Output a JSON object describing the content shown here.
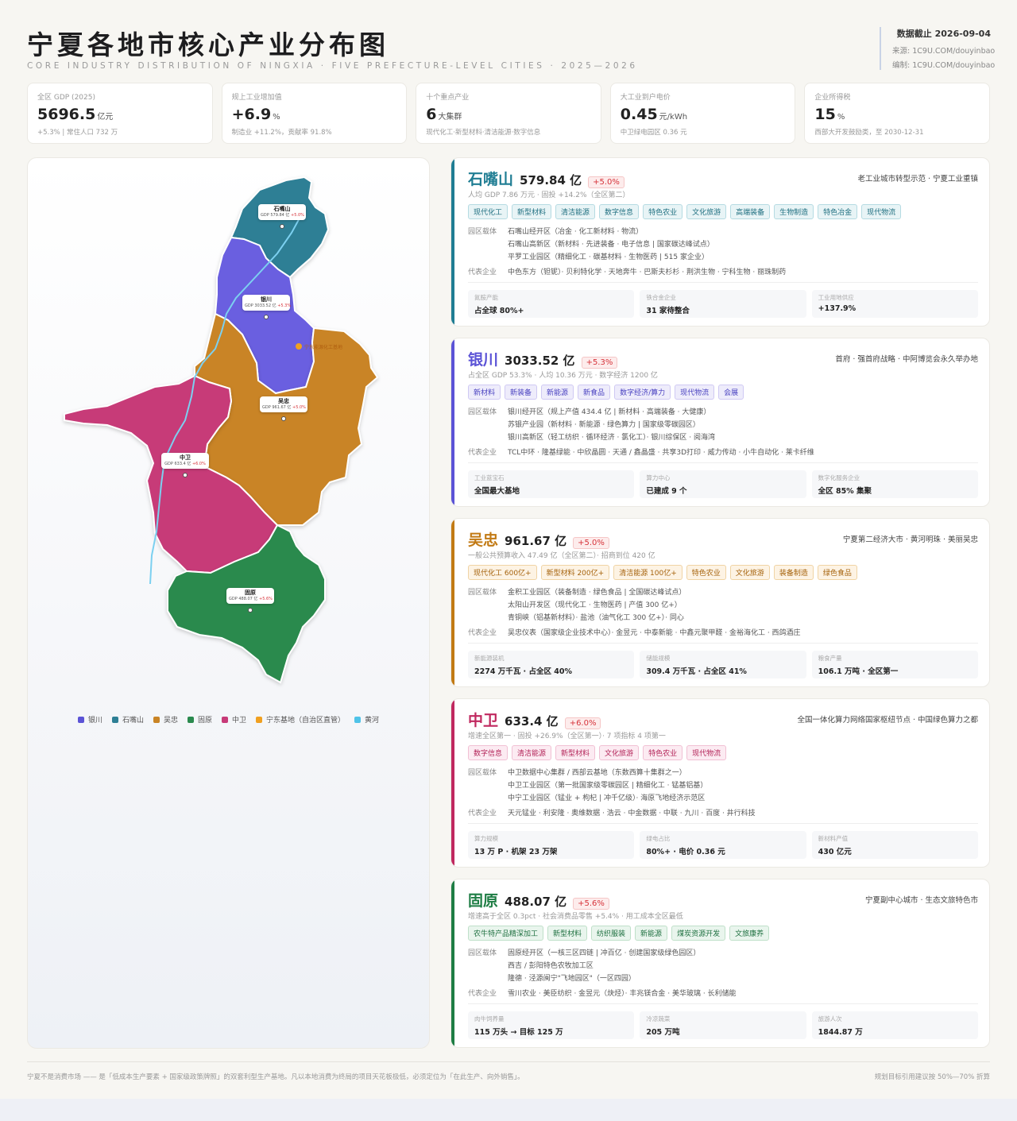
{
  "header": {
    "title": "宁夏各地市核心产业分布图",
    "subtitle": "CORE INDUSTRY DISTRIBUTION OF NINGXIA · FIVE PREFECTURE-LEVEL CITIES · 2025—2026",
    "date": "数据截止 2026-09-04",
    "source": "来源: 1C9U.COM/douyinbao",
    "editor": "编制: 1C9U.COM/douyinbao"
  },
  "kpis": [
    {
      "label": "全区 GDP (2025)",
      "value": "5696.5",
      "unit": "亿元",
      "note": "+5.3% | 常住人口 732 万"
    },
    {
      "label": "规上工业增加值",
      "value": "+6.9",
      "unit": "%",
      "note": "制造业 +11.2%，贡献率 91.8%"
    },
    {
      "label": "十个重点产业",
      "value": "6",
      "unit": "大集群",
      "note": "现代化工·新型材料·清洁能源·数字信息"
    },
    {
      "label": "大工业到户电价",
      "value": "0.45",
      "unit": "元/kWh",
      "note": "中卫绿电园区 0.36 元"
    },
    {
      "label": "企业所得税",
      "value": "15",
      "unit": "%",
      "note": "西部大开发鼓励类，至 2030-12-31"
    }
  ],
  "map": {
    "labels": [
      {
        "name": "石嘴山",
        "gdp": "GDP 579.84 亿",
        "growth": "+5.0%"
      },
      {
        "name": "银川",
        "gdp": "GDP 3033.52 亿",
        "growth": "+5.3%"
      },
      {
        "name": "吴忠",
        "gdp": "GDP 961.67 亿",
        "growth": "+5.0%"
      },
      {
        "name": "中卫",
        "gdp": "GDP 633.4 亿",
        "growth": "+6.0%"
      },
      {
        "name": "固原",
        "gdp": "GDP 488.07 亿",
        "growth": "+5.6%"
      }
    ],
    "base_label": "宁东能源化工基地",
    "legend": [
      {
        "name": "银川",
        "color": "#5b53d6"
      },
      {
        "name": "石嘴山",
        "color": "#2d7f95"
      },
      {
        "name": "吴忠",
        "color": "#c98425"
      },
      {
        "name": "固原",
        "color": "#2a8a4e"
      },
      {
        "name": "中卫",
        "color": "#c73a78"
      },
      {
        "name": "宁东基地（自治区直管）",
        "color": "#f0a020"
      },
      {
        "name": "黄河",
        "color": "#4fc3e8"
      }
    ],
    "colors": {
      "shizuishan": "#2d7f95",
      "yinchuan": "#6b5ee0",
      "wuzhong": "#c98425",
      "zhongwei": "#c73a78",
      "guyuan": "#2a8a4e",
      "river": "#7cd0f0",
      "base": "#f0a020"
    }
  },
  "cities": [
    {
      "name": "石嘴山",
      "gdp": "579.84 亿",
      "growth": "+5.0%",
      "color": "#1f7d93",
      "tagline": "老工业城市转型示范 · 宁夏工业重镇",
      "sub": "人均 GDP 7.86 万元 · 固投 +14.2%（全区第二）",
      "tags": [
        "现代化工",
        "新型材料",
        "清洁能源",
        "数字信息",
        "特色农业",
        "文化旅游",
        "高端装备",
        "生物制造",
        "特色冶金",
        "现代物流"
      ],
      "tag_bg": "#e8f4f6",
      "tag_border": "#b5dbe2",
      "tag_color": "#1f6f80",
      "parks_label": "园区载体",
      "parks": [
        "石嘴山经开区（冶金 · 化工新材料 · 物流）",
        "石嘴山高新区（新材料 · 先进装备 · 电子信息 | 国家碳达峰试点）",
        "平罗工业园区（精细化工 · 碳基材料 · 生物医药 | 515 家企业）"
      ],
      "companies_label": "代表企业",
      "companies": "中色东方（钽铌）· 贝利特化学 · 天地奔牛 · 巴斯夫杉杉 · 荆洪生物 · 宁科生物 · 丽珠制药",
      "stats": [
        {
          "label": "氮胺产能",
          "value": "占全球 80%+"
        },
        {
          "label": "铁合金企业",
          "value": "31 家待整合"
        },
        {
          "label": "工业用地供应",
          "value": "+137.9%"
        }
      ]
    },
    {
      "name": "银川",
      "gdp": "3033.52 亿",
      "growth": "+5.3%",
      "color": "#5b53d6",
      "tagline": "首府 · 强首府战略 · 中阿博览会永久举办地",
      "sub": "占全区 GDP 53.3% · 人均 10.36 万元 · 数字经济 1200 亿",
      "tags": [
        "新材料",
        "新装备",
        "新能源",
        "新食品",
        "数字经济/算力",
        "现代物流",
        "会展"
      ],
      "tag_bg": "#eeecfb",
      "tag_border": "#cfc9f3",
      "tag_color": "#4a42c0",
      "parks_label": "园区载体",
      "parks": [
        "银川经开区（规上产值 434.4 亿 | 新材料 · 高端装备 · 大健康）",
        "苏银产业园（新材料 · 新能源 · 绿色算力 | 国家级零碳园区）",
        "银川高新区（轻工纺织 · 循环经济 · 氯化工）· 银川综保区 · 阅海湾"
      ],
      "companies_label": "代表企业",
      "companies": "TCL中环 · 隆基绿能 · 中欣晶圆 · 天通 / 鑫晶盛 · 共享3D打印 · 威力传动 · 小牛自动化 · 莱卡纤维",
      "stats": [
        {
          "label": "工业蓝宝石",
          "value": "全国最大基地"
        },
        {
          "label": "算力中心",
          "value": "已建成 9 个"
        },
        {
          "label": "数字化服务企业",
          "value": "全区 85% 集聚"
        }
      ]
    },
    {
      "name": "吴忠",
      "gdp": "961.67 亿",
      "growth": "+5.0%",
      "color": "#c27a14",
      "tagline": "宁夏第二经济大市 · 黄河明珠 · 美丽吴忠",
      "sub": "一般公共预算收入 47.49 亿（全区第二）· 招商到位 420 亿",
      "tags": [
        "现代化工 600亿+",
        "新型材料 200亿+",
        "清洁能源 100亿+",
        "特色农业",
        "文化旅游",
        "装备制造",
        "绿色食品"
      ],
      "tag_bg": "#fdf3e4",
      "tag_border": "#f0d4a5",
      "tag_color": "#a5620b",
      "parks_label": "园区载体",
      "parks": [
        "金积工业园区（装备制造 · 绿色食品 | 全国碳达峰试点）",
        "太阳山开发区（现代化工 · 生物医药 | 产值 300 亿+）",
        "青铜峡（铝基新材料）· 盐池（油气化工 300 亿+）· 同心"
      ],
      "companies_label": "代表企业",
      "companies": "吴忠仪表（国家级企业技术中心）· 金昱元 · 中泰新能 · 中鑫元聚甲醛 · 金裕海化工 · 西鸽酒庄",
      "stats": [
        {
          "label": "新能源装机",
          "value": "2274 万千瓦 · 占全区 40%"
        },
        {
          "label": "储能规模",
          "value": "309.4 万千瓦 · 占全区 41%"
        },
        {
          "label": "粮食产量",
          "value": "106.1 万吨 · 全区第一"
        }
      ]
    },
    {
      "name": "中卫",
      "gdp": "633.4 亿",
      "growth": "+6.0%",
      "color": "#c0285f",
      "tagline": "全国一体化算力网络国家枢纽节点 · 中国绿色算力之都",
      "sub": "增速全区第一 · 固投 +26.9%（全区第一）· 7 项指标 4 项第一",
      "tags": [
        "数字信息",
        "清洁能源",
        "新型材料",
        "文化旅游",
        "特色农业",
        "现代物流"
      ],
      "tag_bg": "#fcebf2",
      "tag_border": "#f1c0d4",
      "tag_color": "#b32358",
      "parks_label": "园区载体",
      "parks": [
        "中卫数据中心集群 / 西部云基地（东数西算十集群之一）",
        "中卫工业园区（第一批国家级零碳园区 | 精细化工 · 锰基铝基）",
        "中宁工业园区（锰业 + 枸杞 | 冲千亿级）· 海原飞地经济示范区"
      ],
      "companies_label": "代表企业",
      "companies": "天元锰业 · 利安隆 · 奥维数据 · 浩云 · 中金数据 · 中联 · 九川 · 百度 · 井行科技",
      "stats": [
        {
          "label": "算力规模",
          "value": "13 万 P · 机架 23 万架"
        },
        {
          "label": "绿电占比",
          "value": "80%+ · 电价 0.36 元"
        },
        {
          "label": "新材料产值",
          "value": "430 亿元"
        }
      ]
    },
    {
      "name": "固原",
      "gdp": "488.07 亿",
      "growth": "+5.6%",
      "color": "#1e7d44",
      "tagline": "宁夏副中心城市 · 生态文旅特色市",
      "sub": "增速高于全区 0.3pct · 社会消费品零售 +5.4% · 用工成本全区最低",
      "tags": [
        "农牛特产品精深加工",
        "新型材料",
        "纺织服装",
        "新能源",
        "煤炭资源开发",
        "文旅康养"
      ],
      "tag_bg": "#e9f5ed",
      "tag_border": "#bfe0c9",
      "tag_color": "#1e7040",
      "parks_label": "园区载体",
      "parks": [
        "固原经开区（一核三区四链 | 冲百亿 · 创建国家级绿色园区）",
        "西吉 / 彭阳特色农牧加工区",
        "隆德 · 泾源闽宁\"飞地园区\"（一区四园）"
      ],
      "companies_label": "代表企业",
      "companies": "雪川农业 · 美臣纺织 · 金昱元（炔烃）· 丰兆镁合金 · 美华玻璃 · 长利储能",
      "stats": [
        {
          "label": "肉牛饲养量",
          "value": "115 万头 → 目标 125 万"
        },
        {
          "label": "冷凉蔬菜",
          "value": "205 万吨"
        },
        {
          "label": "旅游人次",
          "value": "1844.87 万"
        }
      ]
    }
  ],
  "footer": {
    "left": "宁夏不是消费市场 —— 是「低成本生产要素 + 国家级政策牌照」的双套利型生产基地。凡以本地消费为终局的项目天花板极低，必须定位为「在此生产、向外销售」。",
    "right": "规划目标引用建议按 50%—70% 折算"
  }
}
